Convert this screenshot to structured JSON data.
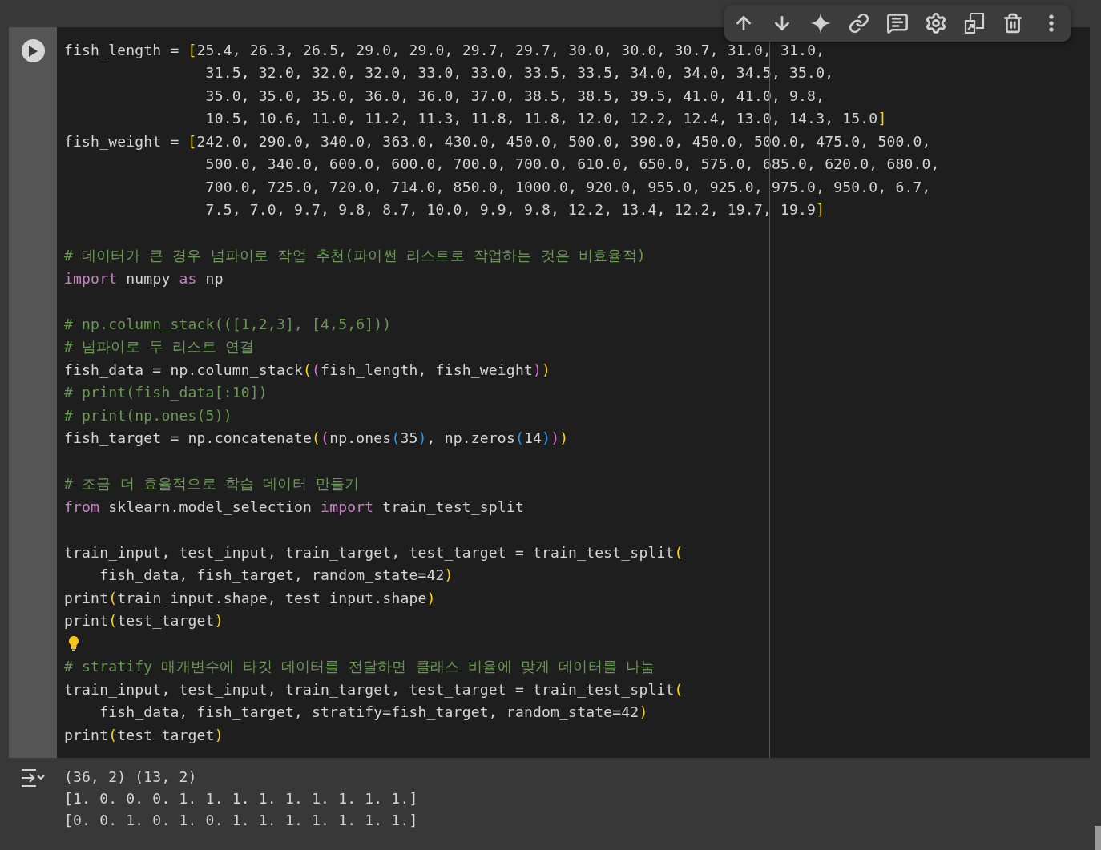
{
  "cell": {
    "code_lines": [
      {
        "kind": "code",
        "tokens": [
          {
            "text": "fish_length = ",
            "kind": "plain"
          },
          {
            "text": "[",
            "kind": "bracket1"
          },
          {
            "text": "25.4, 26.3, 26.5, 29.0, 29.0, 29.7, 29.7, 30.0, 30.0, 30.7, 31.0, 31.0,",
            "kind": "plain"
          }
        ]
      },
      {
        "kind": "code",
        "tokens": [
          {
            "text": "                31.5, 32.0, 32.0, 32.0, 33.0, 33.0, 33.5, 33.5, 34.0, 34.0, 34.5, 35.0,",
            "kind": "plain"
          }
        ]
      },
      {
        "kind": "code",
        "tokens": [
          {
            "text": "                35.0, 35.0, 35.0, 36.0, 36.0, 37.0, 38.5, 38.5, 39.5, 41.0, 41.0, 9.8,",
            "kind": "plain"
          }
        ]
      },
      {
        "kind": "code",
        "tokens": [
          {
            "text": "                10.5, 10.6, 11.0, 11.2, 11.3, 11.8, 11.8, 12.0, 12.2, 12.4, 13.0, 14.3, 15.0",
            "kind": "plain"
          },
          {
            "text": "]",
            "kind": "bracket1"
          }
        ]
      },
      {
        "kind": "code",
        "tokens": [
          {
            "text": "fish_weight = ",
            "kind": "plain"
          },
          {
            "text": "[",
            "kind": "bracket1"
          },
          {
            "text": "242.0, 290.0, 340.0, 363.0, 430.0, 450.0, 500.0, 390.0, 450.0, 500.0, 475.0, 500.0,",
            "kind": "plain"
          }
        ]
      },
      {
        "kind": "code",
        "tokens": [
          {
            "text": "                500.0, 340.0, 600.0, 600.0, 700.0, 700.0, 610.0, 650.0, 575.0, 685.0, 620.0, 680.0,",
            "kind": "plain"
          }
        ]
      },
      {
        "kind": "code",
        "tokens": [
          {
            "text": "                700.0, 725.0, 720.0, 714.0, 850.0, 1000.0, 920.0, 955.0, 925.0, 975.0, 950.0, 6.7,",
            "kind": "plain"
          }
        ]
      },
      {
        "kind": "code",
        "tokens": [
          {
            "text": "                7.5, 7.0, 9.7, 9.8, 8.7, 10.0, 9.9, 9.8, 12.2, 13.4, 12.2, 19.7, 19.9",
            "kind": "plain"
          },
          {
            "text": "]",
            "kind": "bracket1"
          }
        ]
      },
      {
        "kind": "blank"
      },
      {
        "kind": "code",
        "tokens": [
          {
            "text": "# 데이터가 큰 경우 넘파이로 작업 추천(파이썬 리스트로 작업하는 것은 비효율적)",
            "kind": "comment"
          }
        ]
      },
      {
        "kind": "code",
        "tokens": [
          {
            "text": "import",
            "kind": "keyword"
          },
          {
            "text": " numpy ",
            "kind": "plain"
          },
          {
            "text": "as",
            "kind": "keyword"
          },
          {
            "text": " np",
            "kind": "plain"
          }
        ]
      },
      {
        "kind": "blank"
      },
      {
        "kind": "code",
        "tokens": [
          {
            "text": "# np.column_stack(([1,2,3], [4,5,6]))",
            "kind": "comment"
          }
        ]
      },
      {
        "kind": "code",
        "tokens": [
          {
            "text": "# 넘파이로 두 리스트 연결",
            "kind": "comment"
          }
        ]
      },
      {
        "kind": "code",
        "tokens": [
          {
            "text": "fish_data = np.column_stack",
            "kind": "plain"
          },
          {
            "text": "(",
            "kind": "bracket1"
          },
          {
            "text": "(",
            "kind": "bracket2"
          },
          {
            "text": "fish_length, fish_weight",
            "kind": "plain"
          },
          {
            "text": ")",
            "kind": "bracket2"
          },
          {
            "text": ")",
            "kind": "bracket1"
          }
        ]
      },
      {
        "kind": "code",
        "tokens": [
          {
            "text": "# print(fish_data[:10])",
            "kind": "comment"
          }
        ]
      },
      {
        "kind": "code",
        "tokens": [
          {
            "text": "# print(np.ones(5))",
            "kind": "comment"
          }
        ]
      },
      {
        "kind": "code",
        "tokens": [
          {
            "text": "fish_target = np.concatenate",
            "kind": "plain"
          },
          {
            "text": "(",
            "kind": "bracket1"
          },
          {
            "text": "(",
            "kind": "bracket2"
          },
          {
            "text": "np.ones",
            "kind": "plain"
          },
          {
            "text": "(",
            "kind": "bracket3"
          },
          {
            "text": "35",
            "kind": "plain"
          },
          {
            "text": ")",
            "kind": "bracket3"
          },
          {
            "text": ", np.zeros",
            "kind": "plain"
          },
          {
            "text": "(",
            "kind": "bracket3"
          },
          {
            "text": "14",
            "kind": "plain"
          },
          {
            "text": ")",
            "kind": "bracket3"
          },
          {
            "text": ")",
            "kind": "bracket2"
          },
          {
            "text": ")",
            "kind": "bracket1"
          }
        ]
      },
      {
        "kind": "blank"
      },
      {
        "kind": "code",
        "tokens": [
          {
            "text": "# 조금 더 효율적으로 학습 데이터 만들기",
            "kind": "comment"
          }
        ]
      },
      {
        "kind": "code",
        "tokens": [
          {
            "text": "from",
            "kind": "keyword"
          },
          {
            "text": " sklearn.model_selection ",
            "kind": "plain"
          },
          {
            "text": "import",
            "kind": "keyword"
          },
          {
            "text": " train_test_split",
            "kind": "plain"
          }
        ]
      },
      {
        "kind": "blank"
      },
      {
        "kind": "code",
        "tokens": [
          {
            "text": "train_input, test_input, train_target, test_target = train_test_split",
            "kind": "plain"
          },
          {
            "text": "(",
            "kind": "bracket1"
          }
        ]
      },
      {
        "kind": "code",
        "tokens": [
          {
            "text": "    fish_data, fish_target, random_state=42",
            "kind": "plain"
          },
          {
            "text": ")",
            "kind": "bracket1"
          }
        ]
      },
      {
        "kind": "code",
        "tokens": [
          {
            "text": "print",
            "kind": "plain"
          },
          {
            "text": "(",
            "kind": "bracket1"
          },
          {
            "text": "train_input.shape, test_input.shape",
            "kind": "plain"
          },
          {
            "text": ")",
            "kind": "bracket1"
          }
        ]
      },
      {
        "kind": "code",
        "tokens": [
          {
            "text": "print",
            "kind": "plain"
          },
          {
            "text": "(",
            "kind": "bracket1"
          },
          {
            "text": "test_target",
            "kind": "plain"
          },
          {
            "text": ")",
            "kind": "bracket1"
          }
        ]
      },
      {
        "kind": "hint"
      },
      {
        "kind": "code",
        "tokens": [
          {
            "text": "# stratify 매개변수에 타깃 데이터를 전달하면 클래스 비율에 맞게 데이터를 나눔",
            "kind": "comment"
          }
        ]
      },
      {
        "kind": "code",
        "tokens": [
          {
            "text": "train_input, test_input, train_target, test_target = train_test_split",
            "kind": "plain"
          },
          {
            "text": "(",
            "kind": "bracket1"
          }
        ]
      },
      {
        "kind": "code",
        "tokens": [
          {
            "text": "    fish_data, fish_target, stratify=fish_target, random_state=42",
            "kind": "plain"
          },
          {
            "text": ")",
            "kind": "bracket1"
          }
        ]
      },
      {
        "kind": "code",
        "tokens": [
          {
            "text": "print",
            "kind": "plain"
          },
          {
            "text": "(",
            "kind": "bracket1"
          },
          {
            "text": "test_target",
            "kind": "plain"
          },
          {
            "text": ")",
            "kind": "bracket1"
          }
        ]
      }
    ]
  },
  "output": {
    "lines": [
      "(36, 2) (13, 2)",
      "[1. 0. 0. 0. 1. 1. 1. 1. 1. 1. 1. 1. 1.]",
      "[0. 0. 1. 0. 1. 0. 1. 1. 1. 1. 1. 1. 1.]"
    ]
  }
}
